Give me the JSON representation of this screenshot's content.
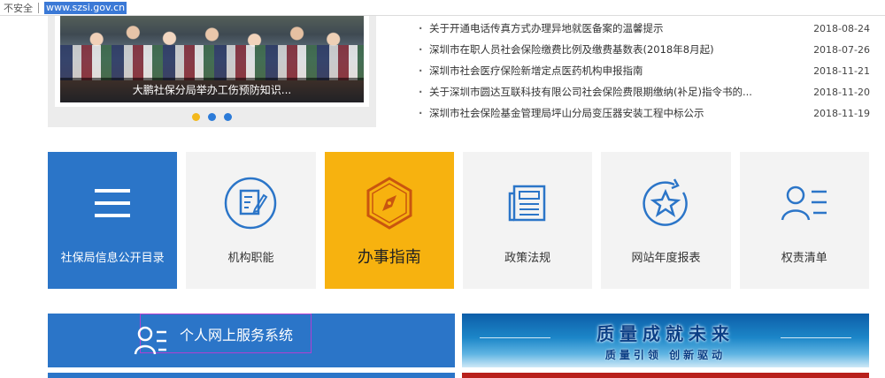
{
  "address_bar": {
    "security_label": "不安全",
    "url": "www.szsi.gov.cn"
  },
  "carousel": {
    "caption": "大鹏社保分局举办工伤预防知识...",
    "dots": 3,
    "active_dot": 1
  },
  "news": [
    {
      "title": "关于开通电话传真方式办理异地就医备案的温馨提示",
      "date": "2018-08-24"
    },
    {
      "title": "深圳市在职人员社会保险缴费比例及缴费基数表(2018年8月起)",
      "date": "2018-07-26"
    },
    {
      "title": "深圳市社会医疗保险新增定点医药机构申报指南",
      "date": "2018-11-21"
    },
    {
      "title": "关于深圳市圆达互联科技有限公司社会保险费限期缴纳(补足)指令书的...",
      "date": "2018-11-20"
    },
    {
      "title": "深圳市社会保险基金管理局坪山分局变压器安装工程中标公示",
      "date": "2018-11-19"
    }
  ],
  "news_bullet": "·",
  "tiles": [
    {
      "label": "社保局信息公开目录",
      "icon": "menu-icon"
    },
    {
      "label": "机构职能",
      "icon": "document-edit-icon"
    },
    {
      "label": "办事指南",
      "icon": "compass-icon"
    },
    {
      "label": "政策法规",
      "icon": "newspaper-icon"
    },
    {
      "label": "网站年度报表",
      "icon": "star-badge-icon"
    },
    {
      "label": "权责清单",
      "icon": "user-list-icon"
    }
  ],
  "service": {
    "label": "个人网上服务系统"
  },
  "quality_banner": {
    "main": "质量成就未来",
    "sub": "质量引领  创新驱动"
  },
  "colors": {
    "brand_blue": "#2b75c8",
    "accent_orange": "#f7b20f",
    "dot_yellow": "#f3b81c"
  }
}
